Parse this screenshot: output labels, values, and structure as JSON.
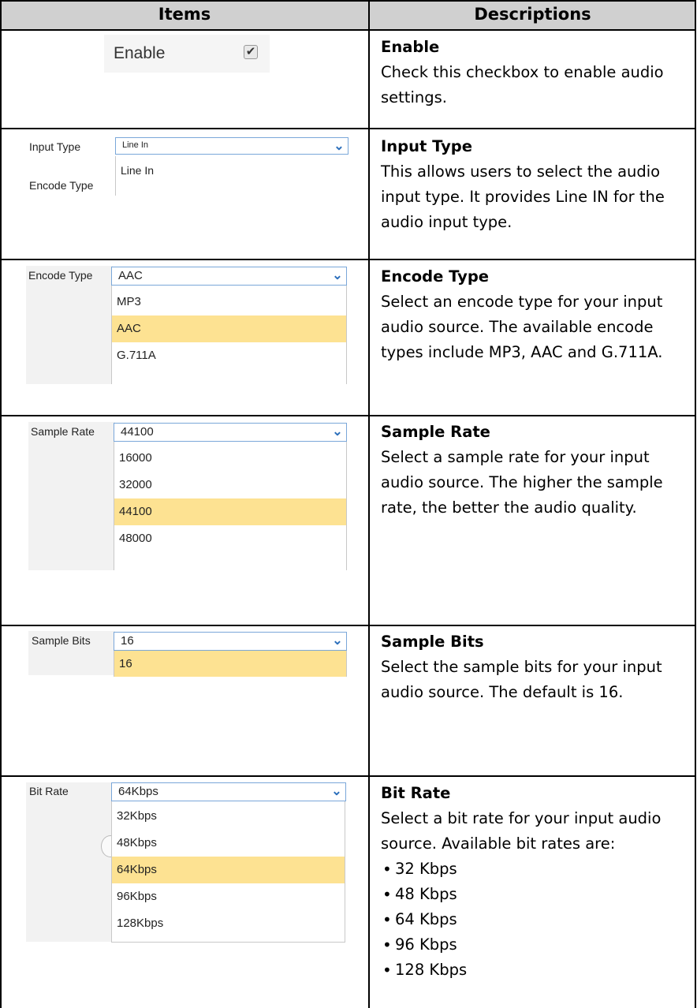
{
  "table": {
    "headers": {
      "items": "Items",
      "descriptions": "Descriptions"
    }
  },
  "rows": {
    "enable": {
      "ui_label": "Enable",
      "checked": true,
      "title": "Enable",
      "text": "Check this checkbox to enable audio settings."
    },
    "input_type": {
      "label_input": "Input Type",
      "label_encode": "Encode Type",
      "select_value": "Line In",
      "option": "Line In",
      "title": "Input Type",
      "text": "This allows users to select the audio input type. It provides Line IN for the audio input type."
    },
    "encode_type": {
      "label": "Encode Type",
      "select_value": "AAC",
      "options": [
        "MP3",
        "AAC",
        "G.711A"
      ],
      "selected": "AAC",
      "title": "Encode Type",
      "text": "Select an encode type for your input audio source. The available encode types include MP3, AAC and G.711A."
    },
    "sample_rate": {
      "label": "Sample Rate",
      "select_value": "44100",
      "options": [
        "16000",
        "32000",
        "44100",
        "48000"
      ],
      "selected": "44100",
      "title": "Sample Rate",
      "text": "Select a sample rate for your input audio source. The higher the sample rate, the better the audio quality."
    },
    "sample_bits": {
      "label": "Sample Bits",
      "select_value": "16",
      "options": [
        "16"
      ],
      "selected": "16",
      "title": "Sample Bits",
      "text": "Select the sample bits for your input audio source. The default is 16."
    },
    "bit_rate": {
      "label": "Bit Rate",
      "select_value": "64Kbps",
      "options": [
        "32Kbps",
        "48Kbps",
        "64Kbps",
        "96Kbps",
        "128Kbps"
      ],
      "selected": "64Kbps",
      "title": "Bit Rate",
      "text": "Select a bit rate for your input audio source. Available bit rates are:",
      "bullets": [
        "32 Kbps",
        "48 Kbps",
        "64 Kbps",
        "96 Kbps",
        "128 Kbps"
      ]
    }
  }
}
